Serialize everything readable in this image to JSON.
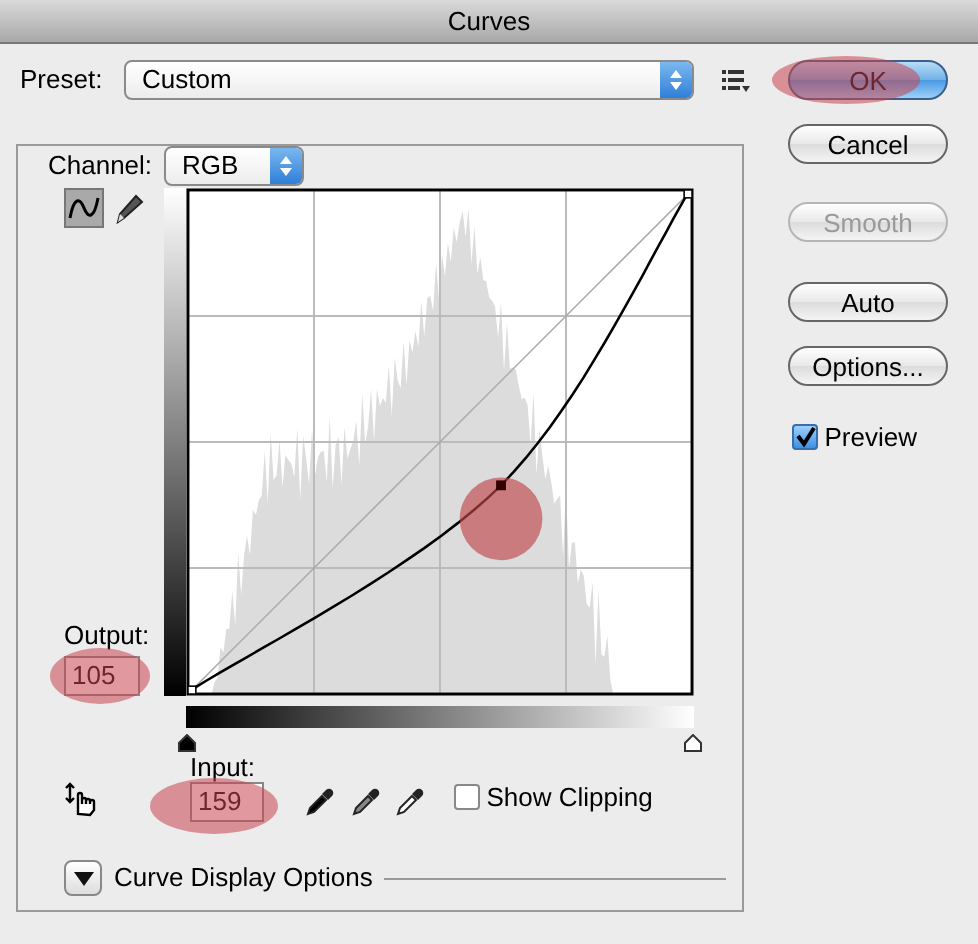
{
  "window": {
    "title": "Curves"
  },
  "preset": {
    "label": "Preset:",
    "value": "Custom"
  },
  "buttons": [
    {
      "label": "OK",
      "kind": "default",
      "disabled": false,
      "highlighted": true
    },
    {
      "label": "Cancel",
      "kind": "normal",
      "disabled": false,
      "highlighted": false
    },
    {
      "label": "Smooth",
      "kind": "normal",
      "disabled": true,
      "highlighted": false
    },
    {
      "label": "Auto",
      "kind": "normal",
      "disabled": false,
      "highlighted": false
    },
    {
      "label": "Options...",
      "kind": "normal",
      "disabled": false,
      "highlighted": false
    }
  ],
  "preview": {
    "label": "Preview",
    "checked": true
  },
  "channel": {
    "label": "Channel:",
    "value": "RGB"
  },
  "tools": [
    {
      "kind": "curve",
      "selected": true
    },
    {
      "kind": "pencil",
      "selected": false
    }
  ],
  "output": {
    "label": "Output:",
    "value": "105",
    "highlighted": true
  },
  "input": {
    "label": "Input:",
    "value": "159",
    "highlighted": true
  },
  "input_sliders": [
    {
      "kind": "shadow"
    },
    {
      "kind": "highlight"
    }
  ],
  "curve_point": {
    "highlighted": true
  },
  "show_clipping": {
    "label": "Show Clipping",
    "checked": false
  },
  "display_options": {
    "label": "Curve Display Options",
    "expanded": false
  }
}
